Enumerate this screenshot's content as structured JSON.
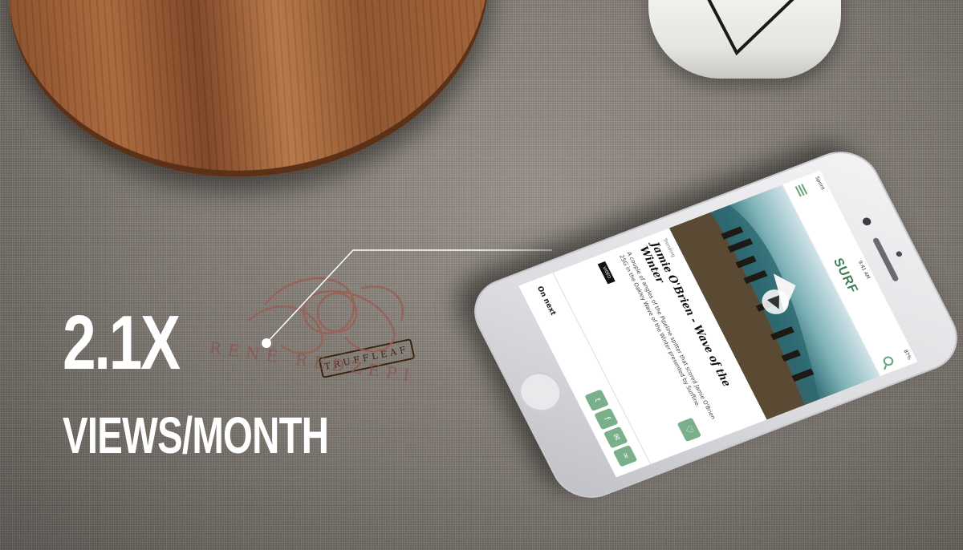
{
  "stat": {
    "value": "2.1X",
    "label": "VIEWS/MONTH"
  },
  "props": {
    "board_brand": "TRUFFLEAF",
    "embroidery_text": "RENÉ REDZEPI"
  },
  "phone": {
    "status": {
      "carrier": "Sprint",
      "time": "9:41 AM",
      "battery": "87%"
    },
    "app": {
      "logo_text": "SURF"
    },
    "article": {
      "kicker": "Trending",
      "headline": "Jamie O'Brien - Wave of the Winter",
      "body": "A couple of angles of the Pipeline spitter that scored Jamie O'Brien 25G in the Oakley Wave of the Winter presented by Surfline.",
      "tag": "VIDEO"
    },
    "footer": {
      "on_next": "On next"
    },
    "share_icons": [
      "twitter-icon",
      "facebook-icon",
      "email-icon",
      "link-icon"
    ],
    "accent_color": "#79b08a"
  }
}
